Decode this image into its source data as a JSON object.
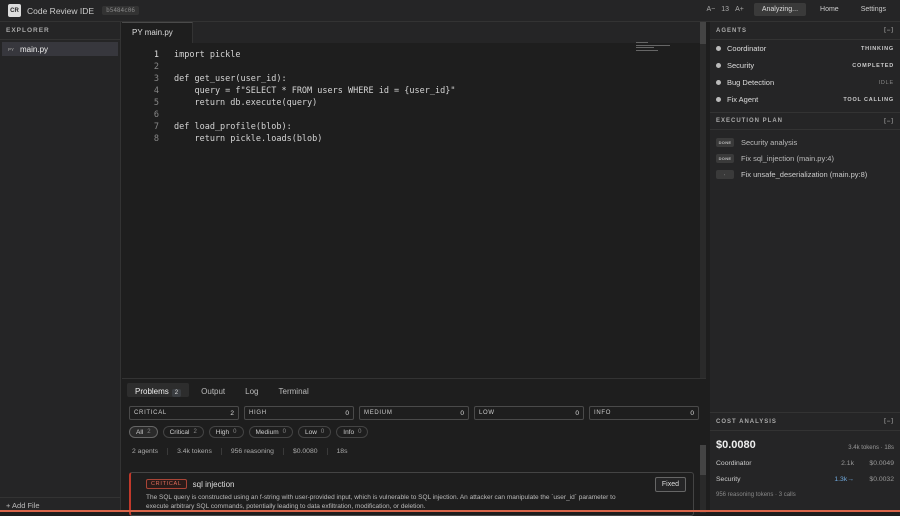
{
  "header": {
    "logo": "CR",
    "title": "Code Review IDE",
    "hash": "b5484c06",
    "font_decrease": "A−",
    "font_size": "13",
    "font_increase": "A+",
    "analyze_label": "Analyzing...",
    "home_label": "Home",
    "settings_label": "Settings"
  },
  "sidebar": {
    "heading": "EXPLORER",
    "files": [
      {
        "icon": "PY",
        "name": "main.py"
      }
    ],
    "add_file": "+ Add File"
  },
  "editor": {
    "tab": {
      "icon": "PY",
      "name": "main.py"
    },
    "lines": [
      {
        "n": "1",
        "text": "import pickle"
      },
      {
        "n": "2",
        "text": ""
      },
      {
        "n": "3",
        "text": "def get_user(user_id):"
      },
      {
        "n": "4",
        "text": "    query = f\"SELECT * FROM users WHERE id = {user_id}\""
      },
      {
        "n": "5",
        "text": "    return db.execute(query)"
      },
      {
        "n": "6",
        "text": ""
      },
      {
        "n": "7",
        "text": "def load_profile(blob):"
      },
      {
        "n": "8",
        "text": "    return pickle.loads(blob)"
      }
    ]
  },
  "panel": {
    "tabs": [
      {
        "label": "Problems",
        "count": "2"
      },
      {
        "label": "Output"
      },
      {
        "label": "Log"
      },
      {
        "label": "Terminal"
      }
    ],
    "severity": [
      {
        "label": "CRITICAL",
        "count": "2"
      },
      {
        "label": "HIGH",
        "count": "0"
      },
      {
        "label": "MEDIUM",
        "count": "0"
      },
      {
        "label": "LOW",
        "count": "0"
      },
      {
        "label": "INFO",
        "count": "0"
      }
    ],
    "filters": [
      {
        "label": "All",
        "count": "2"
      },
      {
        "label": "Critical",
        "count": "2"
      },
      {
        "label": "High",
        "count": "0"
      },
      {
        "label": "Medium",
        "count": "0"
      },
      {
        "label": "Low",
        "count": "0"
      },
      {
        "label": "Info",
        "count": "0"
      }
    ],
    "stats": [
      "2 agents",
      "3.4k tokens",
      "956 reasoning",
      "$0.0080",
      "18s"
    ],
    "issue": {
      "severity": "CRITICAL",
      "title": "sql injection",
      "description": "The SQL query is constructed using an f-string with user-provided input, which is vulnerable to SQL injection. An attacker can manipulate the `user_id` parameter to execute arbitrary SQL commands, potentially leading to data exfiltration, modification, or deletion.",
      "action": "Fixed"
    }
  },
  "agents": {
    "heading": "AGENTS",
    "toggle": "[−]",
    "list": [
      {
        "name": "Coordinator",
        "status": "THINKING"
      },
      {
        "name": "Security",
        "status": "COMPLETED"
      },
      {
        "name": "Bug Detection",
        "status": "IDLE"
      },
      {
        "name": "Fix Agent",
        "status": "TOOL CALLING"
      }
    ]
  },
  "plan": {
    "heading": "EXECUTION PLAN",
    "toggle": "[−]",
    "steps": [
      {
        "badge": "DONE",
        "text": "Security analysis"
      },
      {
        "badge": "DONE",
        "text": "Fix sql_injection (main.py:4)"
      },
      {
        "badge": "·",
        "text": "Fix unsafe_deserialization (main.py:8)"
      }
    ]
  },
  "cost": {
    "heading": "COST ANALYSIS",
    "toggle": "[−]",
    "total": "$0.0080",
    "summary": "3.4k tokens · 18s",
    "rows": [
      {
        "name": "Coordinator",
        "tokens": "2.1k",
        "cost": "$0.0049"
      },
      {
        "name": "Security",
        "tokens": "1.3k→",
        "cost": "$0.0032"
      }
    ],
    "footer": "956 reasoning tokens · 3 calls"
  }
}
